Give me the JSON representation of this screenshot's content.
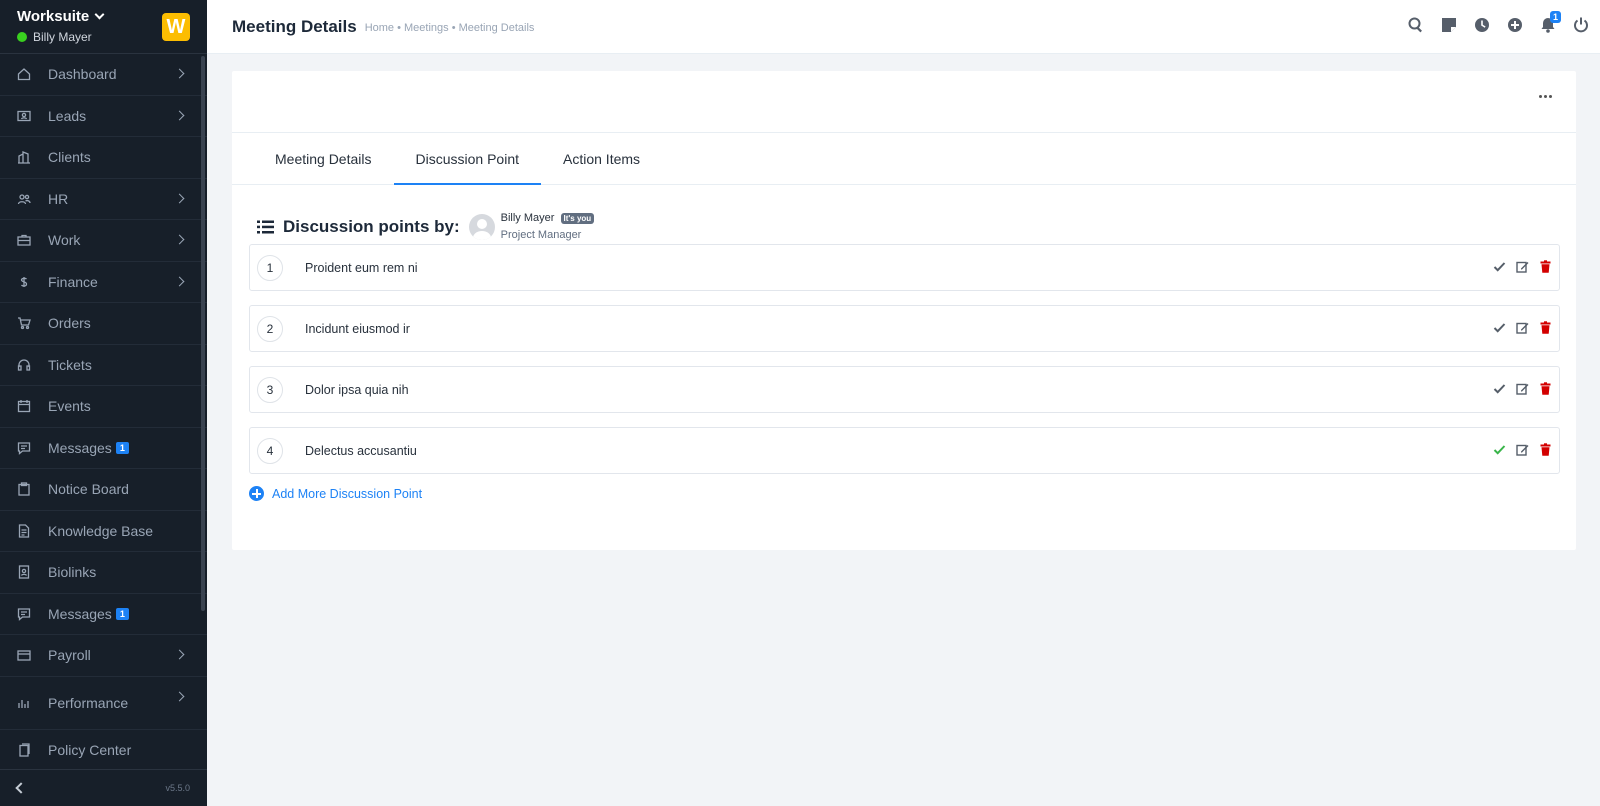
{
  "sidebar": {
    "brand": "Worksuite",
    "user_name": "Billy Mayer",
    "logo_letter": "W",
    "version": "v5.5.0",
    "items": [
      {
        "label": "Dashboard",
        "icon": "house-icon",
        "has_arrow": true
      },
      {
        "label": "Leads",
        "icon": "person-card-icon",
        "has_arrow": true
      },
      {
        "label": "Clients",
        "icon": "building-icon",
        "has_arrow": false
      },
      {
        "label": "HR",
        "icon": "people-icon",
        "has_arrow": true
      },
      {
        "label": "Work",
        "icon": "briefcase-icon",
        "has_arrow": true
      },
      {
        "label": "Finance",
        "icon": "dollar-icon",
        "has_arrow": true
      },
      {
        "label": "Orders",
        "icon": "cart-icon",
        "has_arrow": false
      },
      {
        "label": "Tickets",
        "icon": "headset-icon",
        "has_arrow": false
      },
      {
        "label": "Events",
        "icon": "calendar-icon",
        "has_arrow": false
      },
      {
        "label": "Messages",
        "icon": "chat-icon",
        "has_arrow": false,
        "badge": "1"
      },
      {
        "label": "Notice Board",
        "icon": "clipboard-icon",
        "has_arrow": false
      },
      {
        "label": "Knowledge Base",
        "icon": "document-icon",
        "has_arrow": false
      },
      {
        "label": "Biolinks",
        "icon": "person-badge-icon",
        "has_arrow": false
      },
      {
        "label": "Messages",
        "icon": "chat-icon",
        "has_arrow": false,
        "badge": "1"
      },
      {
        "label": "Payroll",
        "icon": "wallet-icon",
        "has_arrow": true
      },
      {
        "label": "Performance",
        "icon": "bar-chart-icon",
        "has_arrow": true
      },
      {
        "label": "Policy Center",
        "icon": "files-icon",
        "has_arrow": false
      }
    ]
  },
  "header": {
    "title": "Meeting Details",
    "breadcrumb": "Home • Meetings • Meeting Details",
    "notification_count": "1"
  },
  "tabs": [
    {
      "label": "Meeting Details",
      "active": false
    },
    {
      "label": "Discussion Point",
      "active": true
    },
    {
      "label": "Action Items",
      "active": false
    }
  ],
  "section": {
    "title": "Discussion points by:",
    "author_name": "Billy Mayer",
    "author_badge": "It's you",
    "author_role": "Project Manager"
  },
  "points": [
    {
      "number": "1",
      "text": "Proident eum rem ni",
      "completed": false
    },
    {
      "number": "2",
      "text": "Incidunt eiusmod ir",
      "completed": false
    },
    {
      "number": "3",
      "text": "Dolor ipsa quia nih",
      "completed": false
    },
    {
      "number": "4",
      "text": "Delectus accusantiu",
      "completed": true
    }
  ],
  "add_more_label": "Add More Discussion Point",
  "colors": {
    "accent": "#1d82f5",
    "delete": "#d30000",
    "done": "#39b54a",
    "sidebar_bg": "#171f29"
  }
}
